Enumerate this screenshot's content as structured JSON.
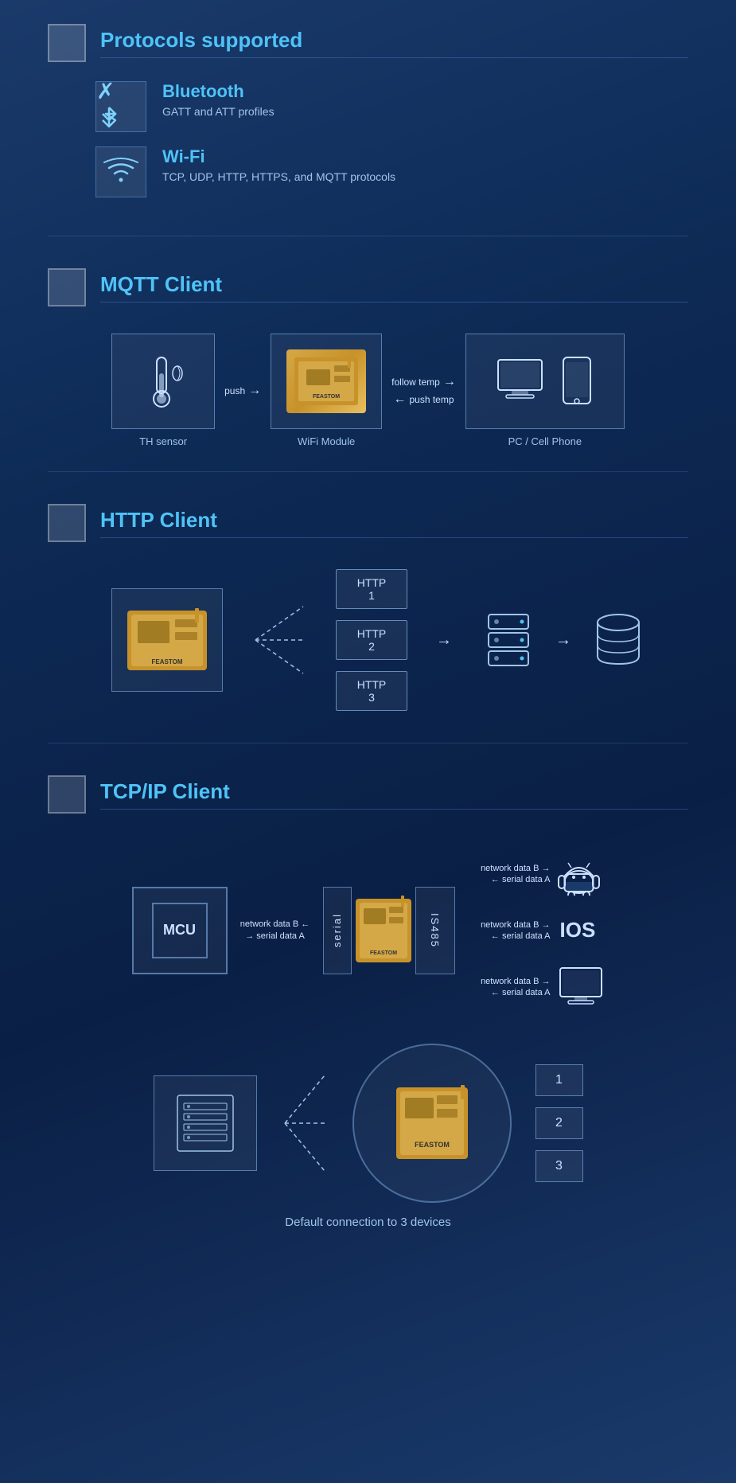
{
  "sections": {
    "protocols": {
      "title": "Protocols supported",
      "bluetooth": {
        "name": "Bluetooth",
        "desc": "GATT and ATT profiles"
      },
      "wifi": {
        "name": "Wi-Fi",
        "desc": "TCP, UDP, HTTP, HTTPS, and MQTT protocols"
      }
    },
    "mqtt": {
      "title": "MQTT Client",
      "sensor_label": "TH sensor",
      "push_label": "push",
      "follow_temp": "follow temp",
      "push_temp": "push temp",
      "module_label": "WiFi Module",
      "module_text": "FEASTOM",
      "pc_label": "PC / Cell Phone"
    },
    "http": {
      "title": "HTTP Client",
      "http1": "HTTP 1",
      "http2": "HTTP 2",
      "http3": "HTTP 3",
      "module_text": "FEASTOM"
    },
    "tcpip": {
      "title": "TCP/IP Client",
      "mcu_label": "MCU",
      "serial_label": "serial",
      "is485_label": "IS485",
      "net_data_b": "network data B",
      "serial_data_a": "serial data A",
      "android_label": "Android",
      "ios_label": "IOS",
      "pc_label": "PC",
      "module_text": "FEASTOM",
      "default_caption": "Default connection to 3 devices",
      "dev1": "1",
      "dev2": "2",
      "dev3": "3"
    }
  }
}
